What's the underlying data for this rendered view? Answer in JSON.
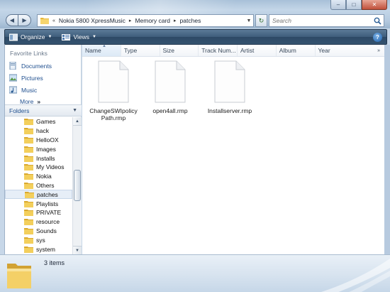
{
  "window": {
    "controls": {
      "minimize": "–",
      "maximize": "□",
      "close": "✕"
    }
  },
  "nav": {
    "back_icon": "arrow-left-icon",
    "forward_icon": "arrow-right-icon"
  },
  "address": {
    "overflow": "«",
    "crumbs": [
      "Nokia 5800 XpressMusic",
      "Memory card",
      "patches"
    ],
    "separator": "▸"
  },
  "search": {
    "placeholder": "Search"
  },
  "toolbar": {
    "organize": "Organize",
    "views": "Views",
    "help": "?"
  },
  "sidebar": {
    "favorite_links_title": "Favorite Links",
    "links": [
      {
        "label": "Documents",
        "icon": "documents-icon"
      },
      {
        "label": "Pictures",
        "icon": "pictures-icon"
      },
      {
        "label": "Music",
        "icon": "music-icon"
      }
    ],
    "more": "More",
    "more_arrows": "»",
    "folders_title": "Folders",
    "folders": [
      "Games",
      "hack",
      "HelloOX",
      "Images",
      "Installs",
      "My Videos",
      "Nokia",
      "Others",
      "patches",
      "Playlists",
      "PRIVATE",
      "resource",
      "Sounds",
      "sys",
      "system"
    ],
    "selected_folder": "patches"
  },
  "columns": [
    "Name",
    "Type",
    "Size",
    "Track Num...",
    "Artist",
    "Album",
    "Year"
  ],
  "files": [
    {
      "name": "ChangeSWIpolicyPath.rmp"
    },
    {
      "name": "open4all.rmp"
    },
    {
      "name": "Installserver.rmp"
    }
  ],
  "details": {
    "item_count": "3 items"
  },
  "colors": {
    "command_bar": "#35536f",
    "link_blue": "#1f4f8f",
    "folder_yellow": "#f2c94c",
    "selection": "#e6eef7"
  }
}
